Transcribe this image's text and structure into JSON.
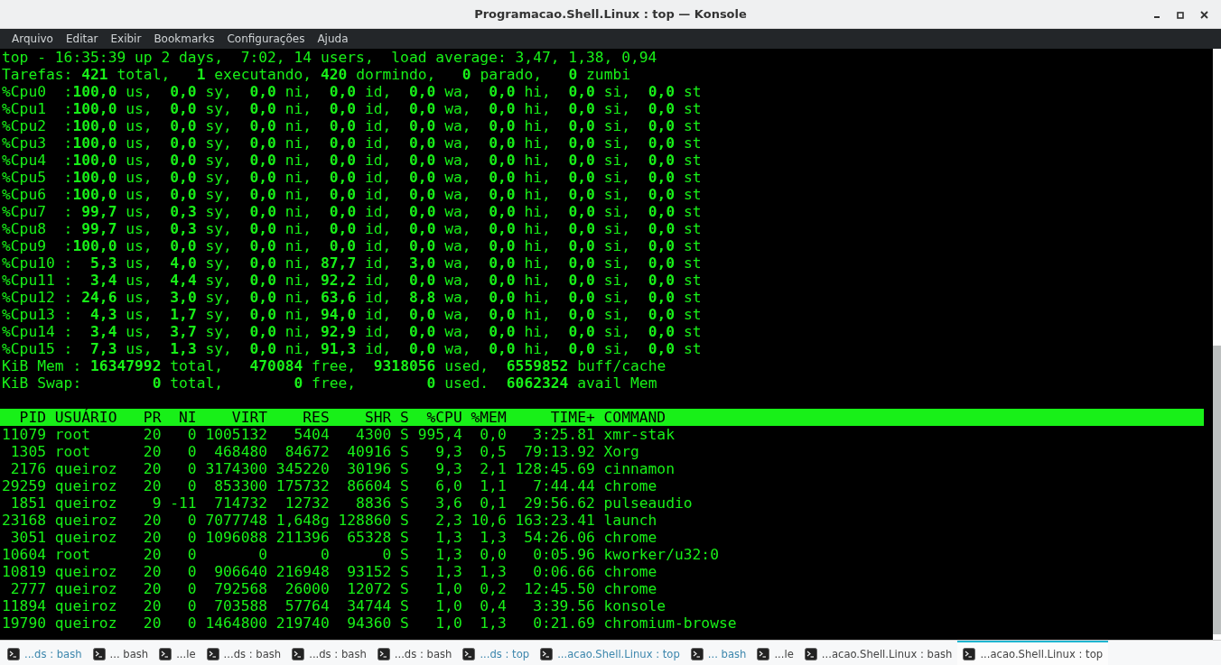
{
  "window": {
    "title": "Programacao.Shell.Linux : top — Konsole"
  },
  "menu": [
    "Arquivo",
    "Editar",
    "Exibir",
    "Bookmarks",
    "Configurações",
    "Ajuda"
  ],
  "terminal": {
    "summary_lines": [
      "top - 16:35:39 up 2 days,  7:02, 14 users,  load average: 3,47, 1,38, 0,94",
      "Tarefas: **421** total,   **1** executando, **420** dormindo,   **0** parado,   **0** zumbi",
      "%Cpu0  :**100,0** us,  **0,0** sy,  **0,0** ni,  **0,0** id,  **0,0** wa,  **0,0** hi,  **0,0** si,  **0,0** st",
      "%Cpu1  :**100,0** us,  **0,0** sy,  **0,0** ni,  **0,0** id,  **0,0** wa,  **0,0** hi,  **0,0** si,  **0,0** st",
      "%Cpu2  :**100,0** us,  **0,0** sy,  **0,0** ni,  **0,0** id,  **0,0** wa,  **0,0** hi,  **0,0** si,  **0,0** st",
      "%Cpu3  :**100,0** us,  **0,0** sy,  **0,0** ni,  **0,0** id,  **0,0** wa,  **0,0** hi,  **0,0** si,  **0,0** st",
      "%Cpu4  :**100,0** us,  **0,0** sy,  **0,0** ni,  **0,0** id,  **0,0** wa,  **0,0** hi,  **0,0** si,  **0,0** st",
      "%Cpu5  :**100,0** us,  **0,0** sy,  **0,0** ni,  **0,0** id,  **0,0** wa,  **0,0** hi,  **0,0** si,  **0,0** st",
      "%Cpu6  :**100,0** us,  **0,0** sy,  **0,0** ni,  **0,0** id,  **0,0** wa,  **0,0** hi,  **0,0** si,  **0,0** st",
      "%Cpu7  : **99,7** us,  **0,3** sy,  **0,0** ni,  **0,0** id,  **0,0** wa,  **0,0** hi,  **0,0** si,  **0,0** st",
      "%Cpu8  : **99,7** us,  **0,3** sy,  **0,0** ni,  **0,0** id,  **0,0** wa,  **0,0** hi,  **0,0** si,  **0,0** st",
      "%Cpu9  :**100,0** us,  **0,0** sy,  **0,0** ni,  **0,0** id,  **0,0** wa,  **0,0** hi,  **0,0** si,  **0,0** st",
      "%Cpu10 :  **5,3** us,  **4,0** sy,  **0,0** ni, **87,7** id,  **3,0** wa,  **0,0** hi,  **0,0** si,  **0,0** st",
      "%Cpu11 :  **3,4** us,  **4,4** sy,  **0,0** ni, **92,2** id,  **0,0** wa,  **0,0** hi,  **0,0** si,  **0,0** st",
      "%Cpu12 : **24,6** us,  **3,0** sy,  **0,0** ni, **63,6** id,  **8,8** wa,  **0,0** hi,  **0,0** si,  **0,0** st",
      "%Cpu13 :  **4,3** us,  **1,7** sy,  **0,0** ni, **94,0** id,  **0,0** wa,  **0,0** hi,  **0,0** si,  **0,0** st",
      "%Cpu14 :  **3,4** us,  **3,7** sy,  **0,0** ni, **92,9** id,  **0,0** wa,  **0,0** hi,  **0,0** si,  **0,0** st",
      "%Cpu15 :  **7,3** us,  **1,3** sy,  **0,0** ni, **91,3** id,  **0,0** wa,  **0,0** hi,  **0,0** si,  **0,0** st",
      "KiB Mem : **16347992** total,   **470084** free,  **9318056** used,  **6559852** buff/cache",
      "KiB Swap:        **0** total,        **0** free,        **0** used.  **6062324** avail Mem"
    ],
    "process_header": "  PID USUÁRIO   PR  NI    VIRT    RES    SHR S  %CPU %MEM     TIME+ COMMAND",
    "process_rows": [
      "11079 root      20   0 1005132   5404   4300 S 995,4  0,0   3:25.81 xmr-stak",
      " 1305 root      20   0  468480  84672  40916 S   9,3  0,5  79:13.92 Xorg",
      " 2176 queiroz   20   0 3174300 345220  30196 S   9,3  2,1 128:45.69 cinnamon",
      "29259 queiroz   20   0  853300 175732  86604 S   6,0  1,1   7:44.44 chrome",
      " 1851 queiroz    9 -11  714732  12732   8836 S   3,6  0,1  29:56.62 pulseaudio",
      "23168 queiroz   20   0 7077748 1,648g 128860 S   2,3 10,6 163:23.41 launch",
      " 3051 queiroz   20   0 1096088 211396  65328 S   1,3  1,3  54:26.06 chrome",
      "10604 root      20   0       0      0      0 S   1,3  0,0   0:05.96 kworker/u32:0",
      "10819 queiroz   20   0  906640 216948  93152 S   1,3  1,3   0:06.66 chrome",
      " 2777 queiroz   20   0  792568  26000  12072 S   1,0  0,2  12:45.50 chrome",
      "11894 queiroz   20   0  703588  57764  34744 S   1,0  0,4   3:39.56 konsole",
      "19790 queiroz   20   0 1464800 219740  94360 S   1,0  1,3   0:21.69 chromium-browse"
    ]
  },
  "tabs": [
    {
      "label": "...ds : bash",
      "activity": true,
      "selected": false
    },
    {
      "label": "... bash",
      "activity": false,
      "selected": false
    },
    {
      "label": "...le",
      "activity": false,
      "selected": false
    },
    {
      "label": "...ds : bash",
      "activity": false,
      "selected": false
    },
    {
      "label": "...ds : bash",
      "activity": false,
      "selected": false
    },
    {
      "label": "...ds : bash",
      "activity": false,
      "selected": false
    },
    {
      "label": "...ds : top",
      "activity": true,
      "selected": false
    },
    {
      "label": "...acao.Shell.Linux : top",
      "activity": true,
      "selected": false
    },
    {
      "label": "... bash",
      "activity": true,
      "selected": false
    },
    {
      "label": "...le",
      "activity": false,
      "selected": false
    },
    {
      "label": "...acao.Shell.Linux : bash",
      "activity": false,
      "selected": false
    },
    {
      "label": "...acao.Shell.Linux : top",
      "activity": false,
      "selected": true
    }
  ]
}
